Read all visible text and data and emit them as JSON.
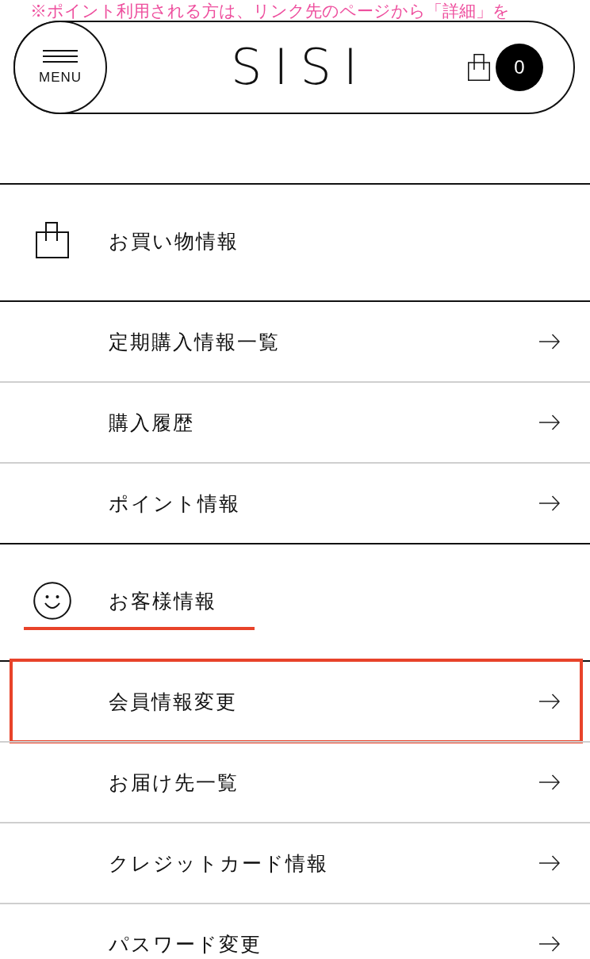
{
  "notice": "※ポイント利用される方は、リンク先のページから「詳細」を",
  "header": {
    "menu_label": "MENU",
    "logo": "SISI",
    "cart_count": "0"
  },
  "sections": [
    {
      "kind": "shopping",
      "title": "お買い物情報",
      "underlined": false,
      "links": [
        {
          "label": "定期購入情報一覧",
          "highlighted": false
        },
        {
          "label": "購入履歴",
          "highlighted": false
        },
        {
          "label": "ポイント情報",
          "highlighted": false
        }
      ]
    },
    {
      "kind": "customer",
      "title": "お客様情報",
      "underlined": true,
      "links": [
        {
          "label": "会員情報変更",
          "highlighted": true
        },
        {
          "label": "お届け先一覧",
          "highlighted": false
        },
        {
          "label": "クレジットカード情報",
          "highlighted": false
        },
        {
          "label": "パスワード変更",
          "highlighted": false
        }
      ]
    }
  ]
}
